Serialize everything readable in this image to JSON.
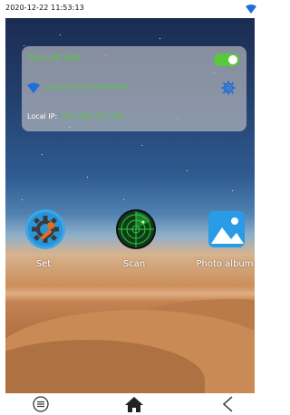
{
  "status_bar": {
    "timestamp": "2020-12-22 11:53:13",
    "wifi_icon": "wifi-icon",
    "wifi_color": "#1e6fd9"
  },
  "wifi_card": {
    "title": "Turn off wifi",
    "toggle_on": true,
    "network_name": "woodpecker-scan4910650864",
    "settings_icon": "gear-icon",
    "local_ip_label": "Local IP:",
    "local_ip_value": "192.168.137.150",
    "accent": "#58c93a"
  },
  "apps": [
    {
      "label": "Set",
      "icon": "wrench-gear-icon"
    },
    {
      "label": "Scan",
      "icon": "radar-icon"
    },
    {
      "label": "Photo album",
      "icon": "picture-icon"
    }
  ],
  "nav_bar": {
    "menu_icon": "menu-icon",
    "home_icon": "home-icon",
    "back_icon": "back-icon"
  }
}
